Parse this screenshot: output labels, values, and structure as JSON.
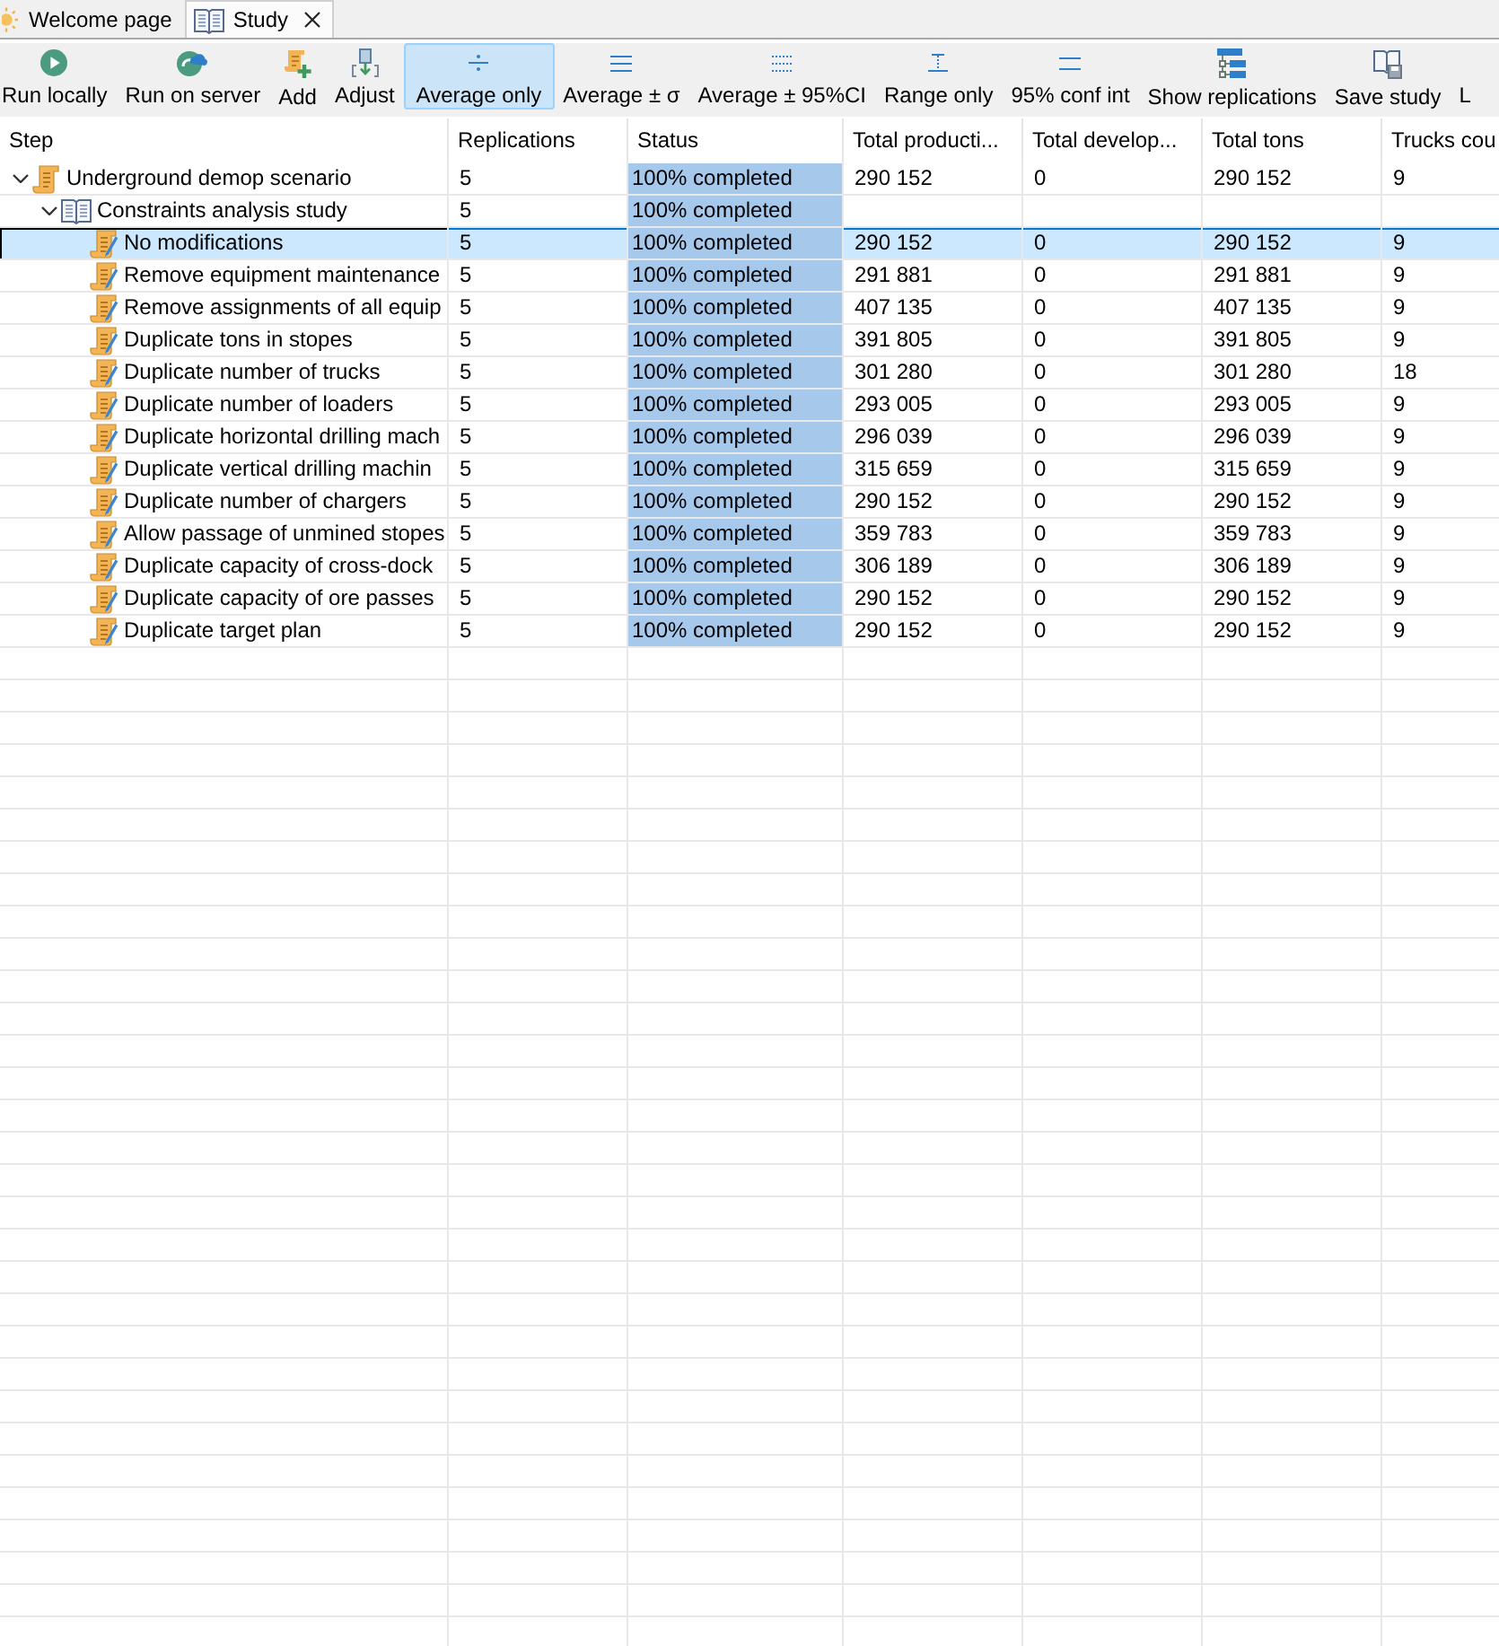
{
  "tabs": [
    {
      "label": "Welcome page",
      "kind": "welcome",
      "selected": false,
      "closable": false
    },
    {
      "label": "Study",
      "kind": "study",
      "selected": true,
      "closable": true
    }
  ],
  "toolbar": [
    {
      "label": "Run locally",
      "kind": "play",
      "selected": false
    },
    {
      "label": "Run on server",
      "kind": "cloud",
      "selected": false
    },
    {
      "label": "Add",
      "kind": "add",
      "selected": false
    },
    {
      "label": "Adjust",
      "kind": "adjust",
      "selected": false
    },
    {
      "label": "Average only",
      "kind": "average",
      "selected": true
    },
    {
      "label": "Average ± σ",
      "kind": "sigma",
      "selected": false
    },
    {
      "label": "Average ± 95%CI",
      "kind": "ci",
      "selected": false
    },
    {
      "label": "Range only",
      "kind": "range",
      "selected": false
    },
    {
      "label": "95% conf int",
      "kind": "conf",
      "selected": false
    },
    {
      "label": "Show replications",
      "kind": "tree",
      "selected": false
    },
    {
      "label": "Save study",
      "kind": "save",
      "selected": false
    },
    {
      "label": "L",
      "kind": "text",
      "selected": false
    }
  ],
  "table": {
    "columns": [
      {
        "label": "Step",
        "kind": "tree"
      },
      {
        "label": "Replications",
        "kind": "text"
      },
      {
        "label": "Status",
        "kind": "progress"
      },
      {
        "label": "Total producti...",
        "kind": "text"
      },
      {
        "label": "Total develop...",
        "kind": "text"
      },
      {
        "label": "Total tons",
        "kind": "text"
      },
      {
        "label": "Trucks cou",
        "kind": "text"
      }
    ],
    "rows": [
      {
        "kind": "scenario",
        "expanded": true,
        "selected": false,
        "level": 1,
        "cells": [
          "Underground demop scenario",
          "5",
          "100% completed",
          "290 152",
          "0",
          "290 152",
          "9"
        ],
        "children": [
          {
            "kind": "study",
            "expanded": true,
            "selected": false,
            "level": 1,
            "cells": [
              "Constraints analysis study",
              "5",
              "100% completed"
            ],
            "children": [
              {
                "kind": "variant",
                "selected": true,
                "level": 1,
                "cells": [
                  "No modifications",
                  "5",
                  "100% completed",
                  "290 152",
                  "0",
                  "290 152",
                  "9"
                ]
              },
              {
                "kind": "variant",
                "selected": false,
                "level": 1,
                "cells": [
                  "Remove equipment maintenance",
                  "5",
                  "100% completed",
                  "291 881",
                  "0",
                  "291 881",
                  "9"
                ]
              },
              {
                "kind": "variant",
                "selected": false,
                "level": 1,
                "cells": [
                  "Remove assignments of all equip",
                  "5",
                  "100% completed",
                  "407 135",
                  "0",
                  "407 135",
                  "9"
                ]
              },
              {
                "kind": "variant",
                "selected": false,
                "level": 1,
                "cells": [
                  "Duplicate tons in stopes",
                  "5",
                  "100% completed",
                  "391 805",
                  "0",
                  "391 805",
                  "9"
                ]
              },
              {
                "kind": "variant",
                "selected": false,
                "level": 1,
                "cells": [
                  "Duplicate number of trucks",
                  "5",
                  "100% completed",
                  "301 280",
                  "0",
                  "301 280",
                  "18"
                ]
              },
              {
                "kind": "variant",
                "selected": false,
                "level": 1,
                "cells": [
                  "Duplicate number of loaders",
                  "5",
                  "100% completed",
                  "293 005",
                  "0",
                  "293 005",
                  "9"
                ]
              },
              {
                "kind": "variant",
                "selected": false,
                "level": 1,
                "cells": [
                  "Duplicate horizontal drilling mach",
                  "5",
                  "100% completed",
                  "296 039",
                  "0",
                  "296 039",
                  "9"
                ]
              },
              {
                "kind": "variant",
                "selected": false,
                "level": 1,
                "cells": [
                  "Duplicate vertical drilling machin",
                  "5",
                  "100% completed",
                  "315 659",
                  "0",
                  "315 659",
                  "9"
                ]
              },
              {
                "kind": "variant",
                "selected": false,
                "level": 1,
                "cells": [
                  "Duplicate number of chargers",
                  "5",
                  "100% completed",
                  "290 152",
                  "0",
                  "290 152",
                  "9"
                ]
              },
              {
                "kind": "variant",
                "selected": false,
                "level": 1,
                "cells": [
                  "Allow passage of unmined stopes",
                  "5",
                  "100% completed",
                  "359 783",
                  "0",
                  "359 783",
                  "9"
                ]
              },
              {
                "kind": "variant",
                "selected": false,
                "level": 1,
                "cells": [
                  "Duplicate capacity of cross-dock",
                  "5",
                  "100% completed",
                  "306 189",
                  "0",
                  "306 189",
                  "9"
                ]
              },
              {
                "kind": "variant",
                "selected": false,
                "level": 1,
                "cells": [
                  "Duplicate capacity of ore passes",
                  "5",
                  "100% completed",
                  "290 152",
                  "0",
                  "290 152",
                  "9"
                ]
              },
              {
                "kind": "variant",
                "selected": false,
                "level": 1,
                "cells": [
                  "Duplicate target plan",
                  "5",
                  "100% completed",
                  "290 152",
                  "0",
                  "290 152",
                  "9"
                ]
              }
            ]
          }
        ]
      }
    ]
  }
}
